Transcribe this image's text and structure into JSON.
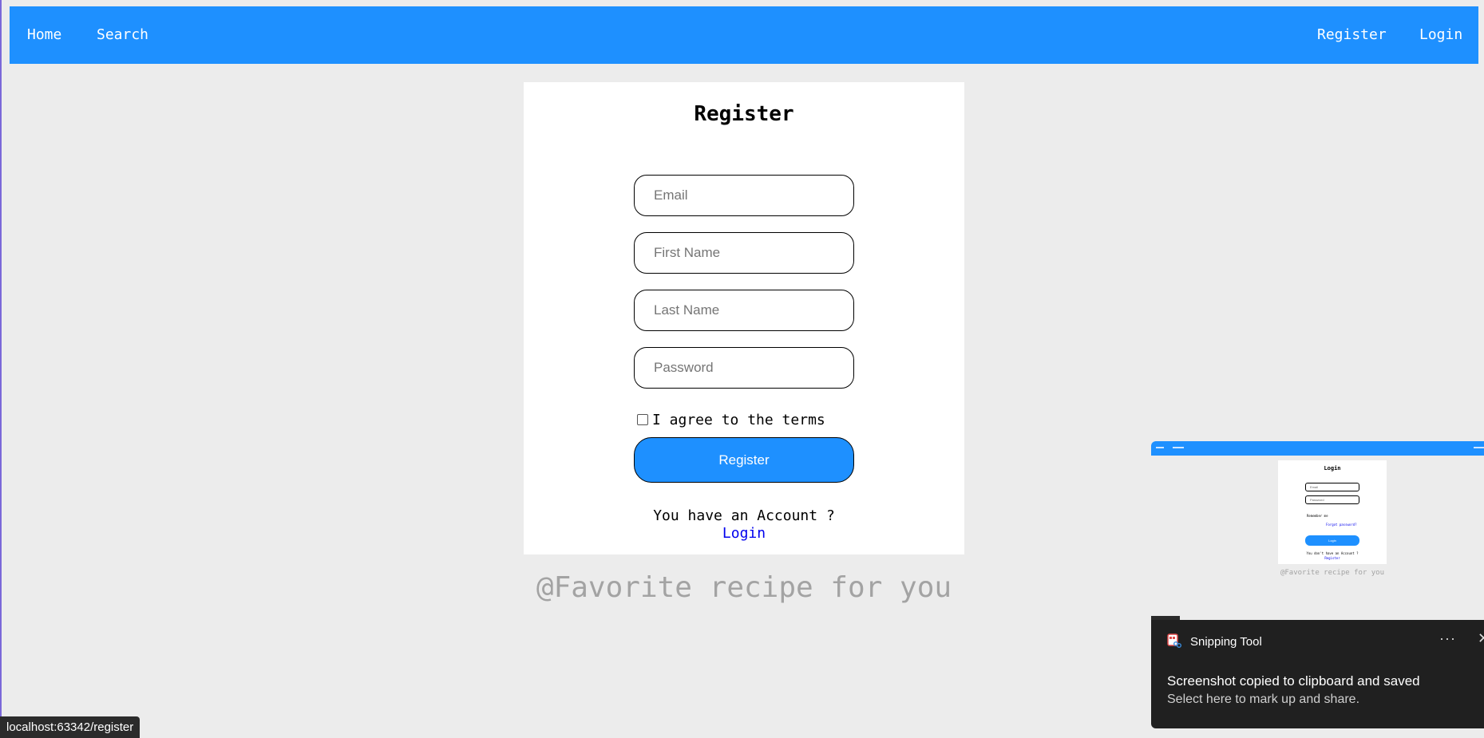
{
  "nav": {
    "home": "Home",
    "search": "Search",
    "register": "Register",
    "login": "Login"
  },
  "form": {
    "title": "Register",
    "email_placeholder": "Email",
    "first_name_placeholder": "First Name",
    "last_name_placeholder": "Last Name",
    "password_placeholder": "Password",
    "terms_label": "I agree to the terms",
    "submit_label": "Register",
    "account_prompt": "You have an Account ?",
    "login_link": "Login"
  },
  "footer": {
    "tagline": "@Favorite recipe for you"
  },
  "status_bar": {
    "url": "localhost:63342/register"
  },
  "thumbnail": {
    "title": "Login",
    "email_placeholder": "Email",
    "password_placeholder": "Password",
    "remember_label": "Remember me",
    "forgot_link": "Forgot password?",
    "button_label": "Login",
    "account_prompt": "You don't have an Account ?",
    "register_link": "Register",
    "tagline": "@Favorite recipe for you"
  },
  "notification": {
    "app_name": "Snipping Tool",
    "title": "Screenshot copied to clipboard and saved",
    "body": "Select here to mark up and share.",
    "more_icon": "···",
    "close_icon": "✕"
  },
  "colors": {
    "accent": "#1e90ff",
    "background": "#ececec",
    "link": "#0000ee",
    "notification_bg": "#202020"
  }
}
